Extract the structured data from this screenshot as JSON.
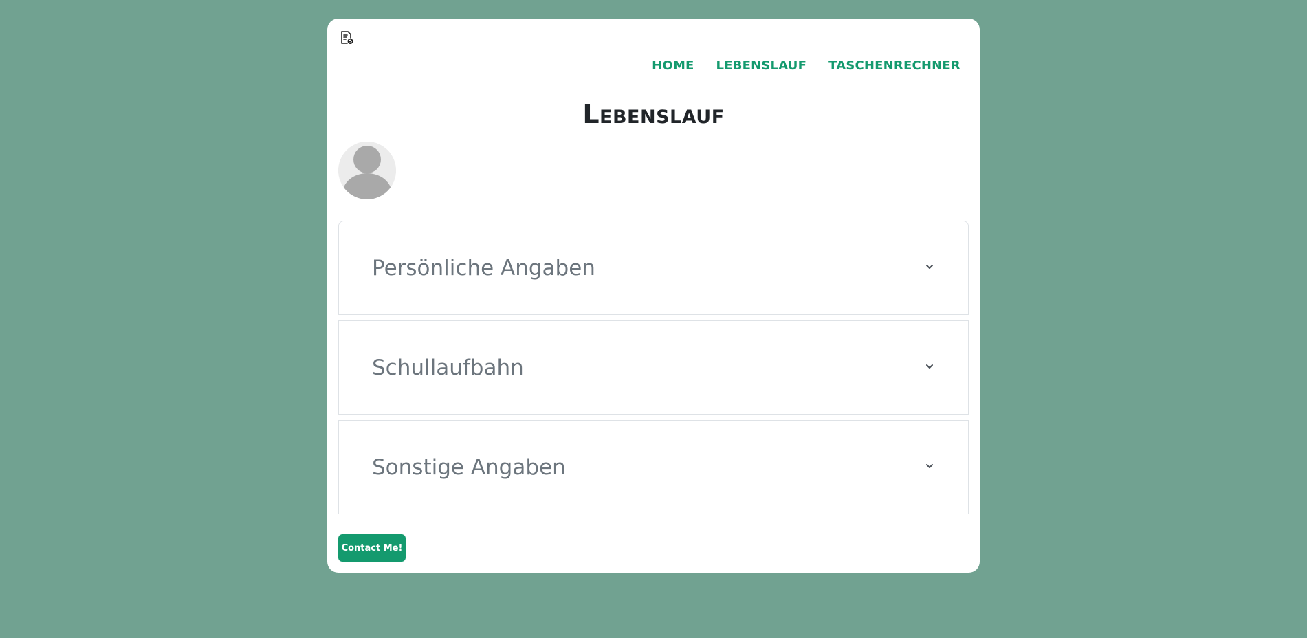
{
  "nav": {
    "items": [
      {
        "label": "HOME"
      },
      {
        "label": "LEBENSLAUF"
      },
      {
        "label": "TASCHENRECHNER"
      }
    ]
  },
  "page": {
    "title": "Lebenslauf"
  },
  "accordion": {
    "items": [
      {
        "label": "Persönliche Angaben"
      },
      {
        "label": "Schullaufbahn"
      },
      {
        "label": "Sonstige Angaben"
      }
    ]
  },
  "contact": {
    "label": "Contact Me!"
  },
  "icons": {
    "logo": "document-certificate-icon",
    "avatar": "user-placeholder-icon",
    "chevron": "chevron-down-icon"
  },
  "colors": {
    "background": "#71a291",
    "accent": "#149a6e",
    "card": "#ffffff",
    "muted_text": "#6c757d"
  }
}
